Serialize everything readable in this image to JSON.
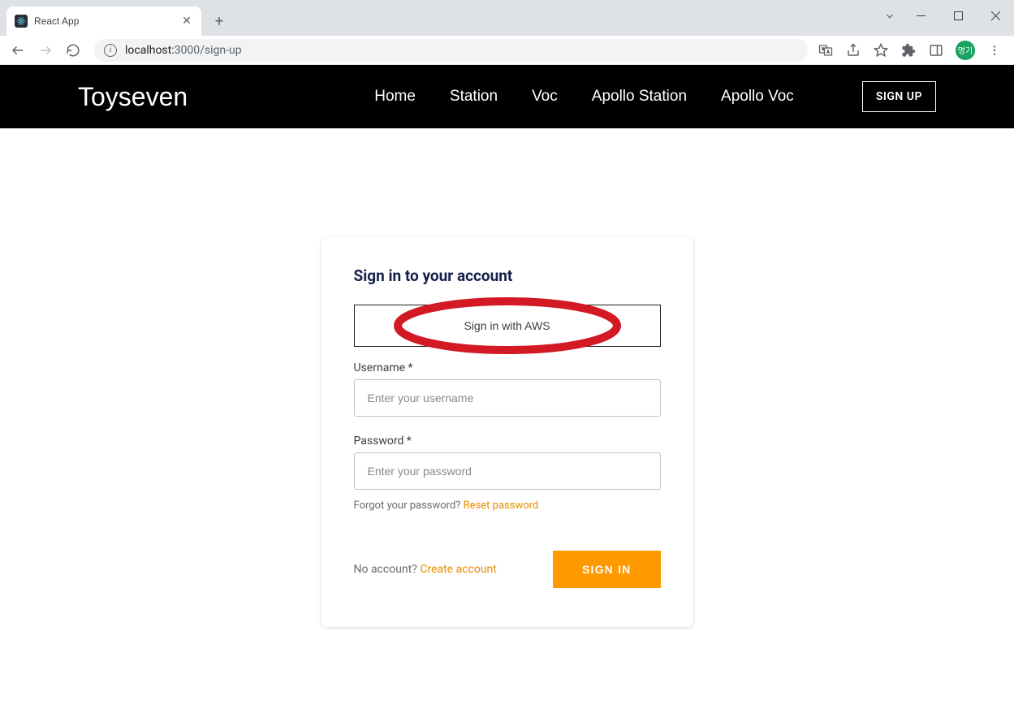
{
  "browser": {
    "tab_title": "React App",
    "url_host": "localhost:",
    "url_port_path": "3000/sign-up",
    "profile_initials": "명기"
  },
  "header": {
    "logo": "Toyseven",
    "nav": [
      "Home",
      "Station",
      "Voc",
      "Apollo Station",
      "Apollo Voc"
    ],
    "signup_label": "SIGN UP"
  },
  "card": {
    "title": "Sign in to your account",
    "aws_button": "Sign in with AWS",
    "username_label": "Username *",
    "username_placeholder": "Enter your username",
    "password_label": "Password *",
    "password_placeholder": "Enter your password",
    "forgot_text": "Forgot your password? ",
    "reset_link": "Reset password",
    "no_account_text": "No account? ",
    "create_link": "Create account",
    "signin_label": "SIGN IN"
  }
}
